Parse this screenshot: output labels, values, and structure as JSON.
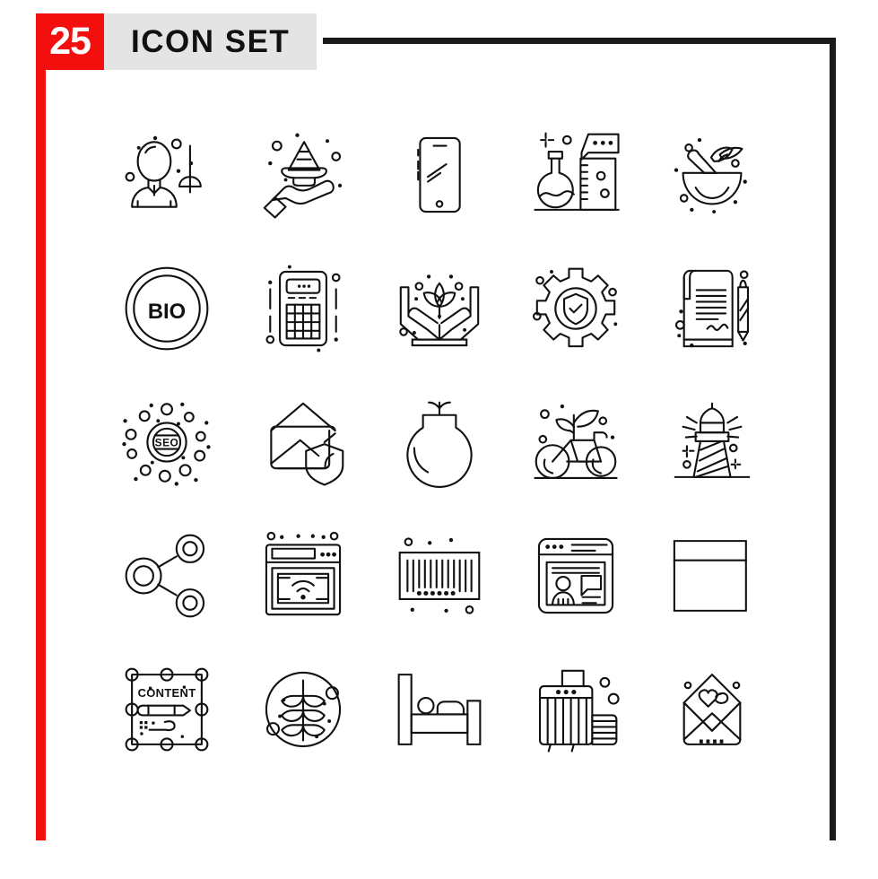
{
  "header": {
    "count": "25",
    "title": "Icon Set",
    "badge_color": "#f40f0f",
    "plate_color": "#e4e4e4",
    "frame_color": "#1a1a1a"
  },
  "grid": {
    "columns": 5,
    "rows": 5,
    "total": 25
  },
  "icons": [
    {
      "id": "fencing-player",
      "name": "fencing-player-icon",
      "label": "Fencing Player",
      "row": 1,
      "col": 1
    },
    {
      "id": "hand-cone",
      "name": "hand-holding-cone-icon",
      "label": "Hand Holding Cone",
      "row": 1,
      "col": 2
    },
    {
      "id": "smartphone",
      "name": "smartphone-icon",
      "label": "Smartphone",
      "row": 1,
      "col": 3
    },
    {
      "id": "chemistry-lab",
      "name": "chemistry-lab-icon",
      "label": "Chemistry Lab",
      "row": 1,
      "col": 4
    },
    {
      "id": "mortar-pestle",
      "name": "mortar-and-pestle-icon",
      "label": "Mortar And Pestle",
      "row": 1,
      "col": 5
    },
    {
      "id": "bio-badge",
      "name": "bio-badge-icon",
      "label": "Bio Badge",
      "row": 2,
      "col": 1,
      "text": "BIO"
    },
    {
      "id": "calculator",
      "name": "calculator-icon",
      "label": "Calculator",
      "row": 2,
      "col": 2
    },
    {
      "id": "hands-plant",
      "name": "hands-holding-plant-icon",
      "label": "Hands Holding Plant",
      "row": 2,
      "col": 3
    },
    {
      "id": "gear-shield",
      "name": "gear-shield-icon",
      "label": "Gear Shield",
      "row": 2,
      "col": 4
    },
    {
      "id": "contract-pen",
      "name": "contract-with-pen-icon",
      "label": "Contract With Pen",
      "row": 2,
      "col": 5
    },
    {
      "id": "seo-network",
      "name": "seo-network-icon",
      "label": "Seo Network",
      "row": 3,
      "col": 1,
      "text": "SEO"
    },
    {
      "id": "secure-mail",
      "name": "secure-mail-icon",
      "label": "Secure Mail",
      "row": 3,
      "col": 2
    },
    {
      "id": "seed-bulb",
      "name": "seed-bulb-icon",
      "label": "Seed Bulb",
      "row": 3,
      "col": 3
    },
    {
      "id": "eco-bicycle",
      "name": "eco-bicycle-icon",
      "label": "Eco Bicycle",
      "row": 3,
      "col": 4
    },
    {
      "id": "lighthouse",
      "name": "lighthouse-icon",
      "label": "Lighthouse",
      "row": 3,
      "col": 5
    },
    {
      "id": "share-network",
      "name": "share-network-icon",
      "label": "Share Network",
      "row": 4,
      "col": 1
    },
    {
      "id": "browser-wifi",
      "name": "browser-wifi-icon",
      "label": "Browser Wifi",
      "row": 4,
      "col": 2
    },
    {
      "id": "barcode",
      "name": "barcode-icon",
      "label": "Barcode",
      "row": 4,
      "col": 3
    },
    {
      "id": "webinar-window",
      "name": "webinar-window-icon",
      "label": "Webinar Window",
      "row": 4,
      "col": 4
    },
    {
      "id": "browser-window",
      "name": "browser-window-icon",
      "label": "Browser Window",
      "row": 4,
      "col": 5
    },
    {
      "id": "content-editor",
      "name": "content-editor-icon",
      "label": "Content Editor",
      "row": 5,
      "col": 1,
      "text": "CONTENT"
    },
    {
      "id": "botany-circle",
      "name": "botany-plant-circle-icon",
      "label": "Botany Plant",
      "row": 5,
      "col": 2
    },
    {
      "id": "bed",
      "name": "bed-icon",
      "label": "Bed",
      "row": 5,
      "col": 3
    },
    {
      "id": "luggage",
      "name": "luggage-icon",
      "label": "Luggage",
      "row": 5,
      "col": 4
    },
    {
      "id": "love-letter",
      "name": "love-letter-icon",
      "label": "Love Letter",
      "row": 5,
      "col": 5
    }
  ]
}
